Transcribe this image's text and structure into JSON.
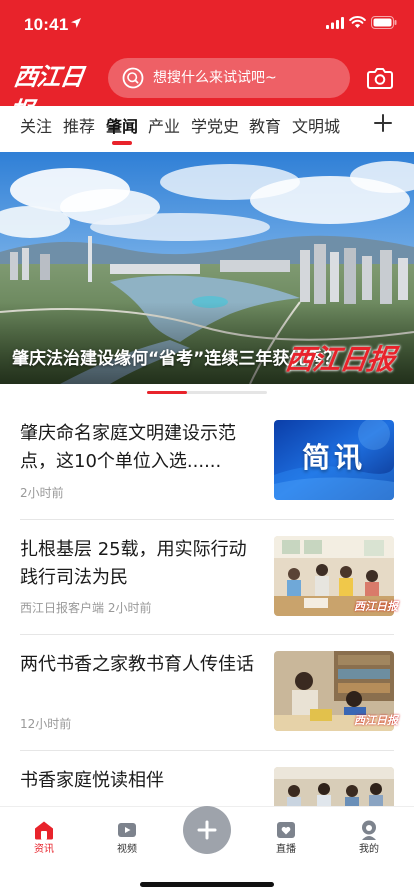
{
  "status_bar": {
    "time": "10:41"
  },
  "header": {
    "logo_text": "西江日报",
    "search_placeholder": "想搜什么来试试吧~"
  },
  "tabs": [
    {
      "label": "关注"
    },
    {
      "label": "推荐"
    },
    {
      "label": "肇闻",
      "active": true
    },
    {
      "label": "产业"
    },
    {
      "label": "学党史"
    },
    {
      "label": "教育"
    },
    {
      "label": "文明城"
    }
  ],
  "banner": {
    "caption": "肇庆法治建设缘何“省考”连续三年获优秀？",
    "watermark": "西江日报",
    "slide_index": 1,
    "slide_count": 3
  },
  "news": [
    {
      "title": "肇庆命名家庭文明建设示范点，这10个单位入选......",
      "meta": "2小时前",
      "thumb_text": "简讯",
      "thumb_type": "brief"
    },
    {
      "title": "扎根基层 25载，用实际行动践行司法为民",
      "meta": "西江日报客户端 2小时前",
      "thumb_watermark": "西江日报",
      "thumb_type": "photo-classroom"
    },
    {
      "title": "两代书香之家教书育人传佳话",
      "meta": "12小时前",
      "thumb_watermark": "西江日报",
      "thumb_type": "photo-reading"
    },
    {
      "title": "书香家庭悦读相伴",
      "meta": "",
      "thumb_type": "photo-family"
    }
  ],
  "bottom_nav": [
    {
      "label": "资讯",
      "icon": "home-icon",
      "active": true
    },
    {
      "label": "视频",
      "icon": "video-icon"
    },
    {
      "label": "",
      "icon": "plus-icon"
    },
    {
      "label": "直播",
      "icon": "live-icon"
    },
    {
      "label": "我的",
      "icon": "profile-icon"
    }
  ],
  "colors": {
    "brand_red": "#e8232b",
    "fab_gray": "#9ea3ab"
  }
}
